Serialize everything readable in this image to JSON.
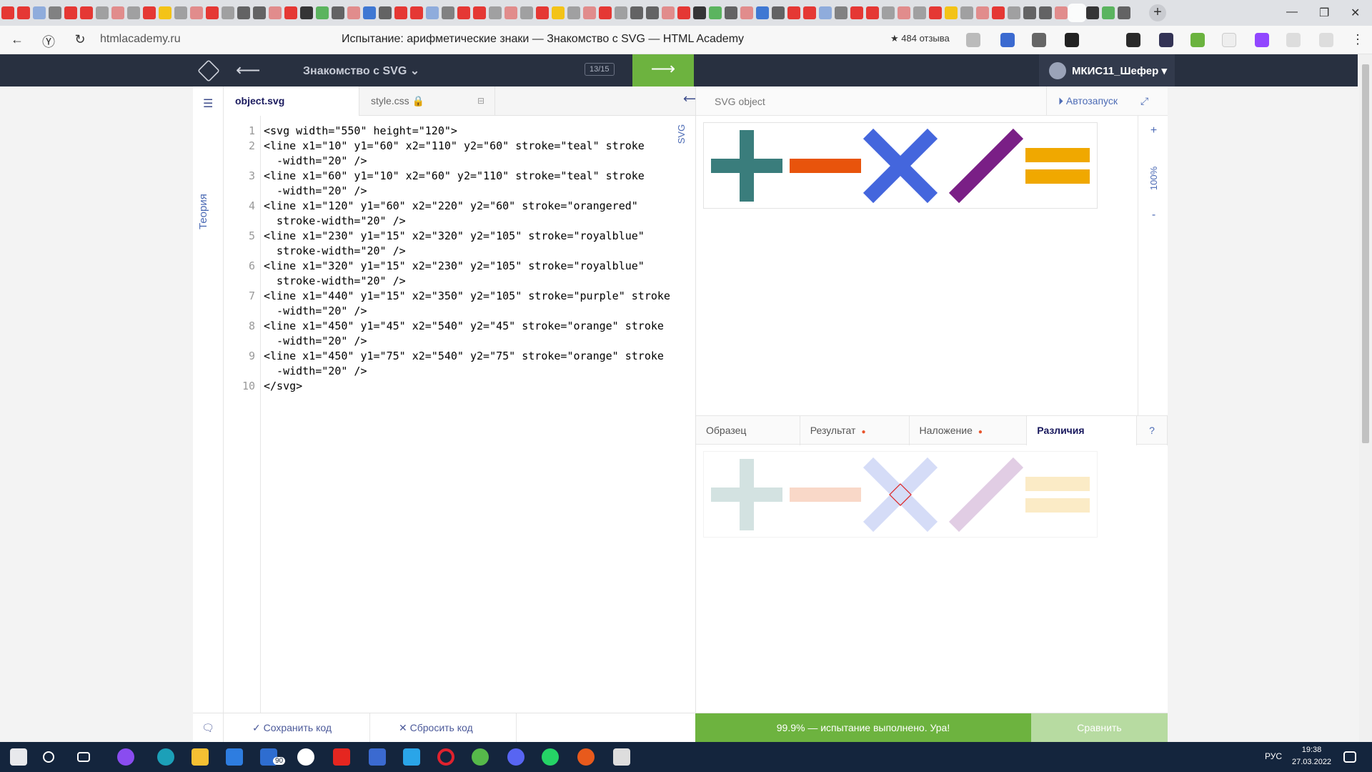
{
  "browser": {
    "url": "htmlacademy.ru",
    "title": "Испытание: арифметические знаки — Знакомство с SVG — HTML Academy",
    "rating": "★ 484 отзыва"
  },
  "header": {
    "course": "Знакомство с SVG ⌄",
    "counter": "13/15",
    "user": "МКИС11_Шефер ▾"
  },
  "sidebar": {
    "theory": "Теория"
  },
  "editor": {
    "tabs": [
      {
        "label": "object.svg"
      },
      {
        "label": "style.css 🔒"
      }
    ],
    "lines": [
      {
        "n": "1",
        "text": "<svg width=\"550\" height=\"120\">"
      },
      {
        "n": "2",
        "text": "<line x1=\"10\" y1=\"60\" x2=\"110\" y2=\"60\" stroke=\"teal\" stroke"
      },
      {
        "n": "",
        "text": "  -width=\"20\" />"
      },
      {
        "n": "3",
        "text": "<line x1=\"60\" y1=\"10\" x2=\"60\" y2=\"110\" stroke=\"teal\" stroke"
      },
      {
        "n": "",
        "text": "  -width=\"20\" />"
      },
      {
        "n": "4",
        "text": "<line x1=\"120\" y1=\"60\" x2=\"220\" y2=\"60\" stroke=\"orangered\""
      },
      {
        "n": "",
        "text": "  stroke-width=\"20\" />"
      },
      {
        "n": "5",
        "text": "<line x1=\"230\" y1=\"15\" x2=\"320\" y2=\"105\" stroke=\"royalblue\""
      },
      {
        "n": "",
        "text": "  stroke-width=\"20\" />"
      },
      {
        "n": "6",
        "text": "<line x1=\"320\" y1=\"15\" x2=\"230\" y2=\"105\" stroke=\"royalblue\""
      },
      {
        "n": "",
        "text": "  stroke-width=\"20\" />"
      },
      {
        "n": "7",
        "text": "<line x1=\"440\" y1=\"15\" x2=\"350\" y2=\"105\" stroke=\"purple\" stroke"
      },
      {
        "n": "",
        "text": "  -width=\"20\" />"
      },
      {
        "n": "8",
        "text": "<line x1=\"450\" y1=\"45\" x2=\"540\" y2=\"45\" stroke=\"orange\" stroke"
      },
      {
        "n": "",
        "text": "  -width=\"20\" />"
      },
      {
        "n": "9",
        "text": "<line x1=\"450\" y1=\"75\" x2=\"540\" y2=\"75\" stroke=\"orange\" stroke"
      },
      {
        "n": "",
        "text": "  -width=\"20\" />"
      },
      {
        "n": "10",
        "text": "</svg>"
      }
    ],
    "svg_label": "SVG"
  },
  "preview": {
    "title": "SVG object",
    "autorun": "Автозапуск",
    "zoom": "100%",
    "zoom_in": "+",
    "zoom_out": "-"
  },
  "diff_tabs": [
    {
      "label": "Образец",
      "dot": false
    },
    {
      "label": "Результат",
      "dot": true
    },
    {
      "label": "Наложение",
      "dot": true
    },
    {
      "label": "Различия",
      "dot": false
    }
  ],
  "help": "?",
  "footer": {
    "save": "Сохранить код",
    "reset": "Сбросить код",
    "result": "99.9% — испытание выполнено. Ура!",
    "compare": "Сравнить"
  },
  "taskbar": {
    "time": "19:38",
    "date": "27.03.2022",
    "lang": "РУС",
    "badge": "90"
  },
  "colors": {
    "teal": "#3a7d7c",
    "orangered": "#e8540c",
    "royalblue": "#4466dd",
    "purple": "#7a1f86",
    "orange": "#f0a800",
    "accent_green": "#6db33f",
    "header_bg": "#283040"
  }
}
